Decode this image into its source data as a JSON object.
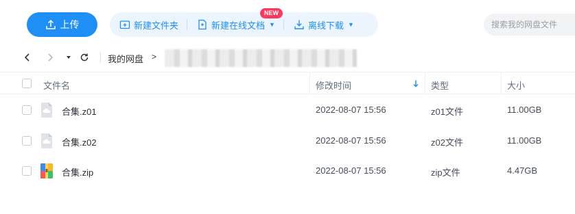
{
  "toolbar": {
    "upload_label": "上传",
    "actions": [
      {
        "label": "新建文件夹",
        "icon": "new-folder-icon"
      },
      {
        "label": "新建在线文档",
        "icon": "new-doc-icon",
        "badge": "NEW"
      },
      {
        "label": "离线下载",
        "icon": "offline-download-icon"
      }
    ],
    "search_placeholder": "搜索我的网盘文件"
  },
  "nav": {
    "root": "我的网盘",
    "separator": ">"
  },
  "columns": {
    "name": "文件名",
    "modified": "修改时间",
    "type": "类型",
    "size": "大小"
  },
  "files": [
    {
      "name": "合集.z01",
      "modified": "2022-08-07 15:56",
      "type": "z01文件",
      "size": "11.00GB",
      "icon": "archive-part-icon"
    },
    {
      "name": "合集.z02",
      "modified": "2022-08-07 15:56",
      "type": "z02文件",
      "size": "11.00GB",
      "icon": "archive-part-icon"
    },
    {
      "name": "合集.zip",
      "modified": "2022-08-07 15:56",
      "type": "zip文件",
      "size": "4.47GB",
      "icon": "zip-archive-icon"
    }
  ],
  "colors": {
    "accent": "#1f8ff5",
    "badge": "#f73b5e",
    "action_group_bg": "#ecf5fe"
  }
}
